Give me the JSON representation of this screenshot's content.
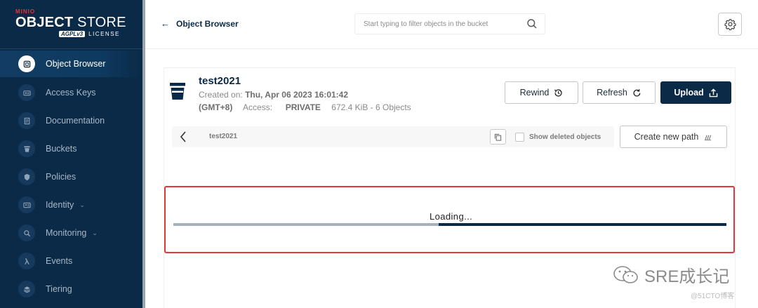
{
  "sidebar": {
    "logo": {
      "minio": "MINIO",
      "title_bold": "OBJECT",
      "title_rest": " STORE",
      "agpl": "AGPLv3",
      "license": "LICENSE"
    },
    "items": [
      {
        "label": "Object Browser",
        "icon": "object-browser-icon",
        "active": true
      },
      {
        "label": "Access Keys",
        "icon": "access-keys-icon"
      },
      {
        "label": "Documentation",
        "icon": "documentation-icon"
      },
      {
        "label": "Buckets",
        "icon": "buckets-icon"
      },
      {
        "label": "Policies",
        "icon": "policies-icon"
      },
      {
        "label": "Identity",
        "icon": "identity-icon",
        "expandable": true
      },
      {
        "label": "Monitoring",
        "icon": "monitoring-icon",
        "expandable": true
      },
      {
        "label": "Events",
        "icon": "events-icon"
      },
      {
        "label": "Tiering",
        "icon": "tiering-icon"
      }
    ]
  },
  "topbar": {
    "back_label": "Object Browser",
    "search_placeholder": "Start typing to filter objects in the bucket"
  },
  "bucket": {
    "name": "test2021",
    "created_label": "Created on:",
    "created_value": "Thu, Apr 06 2023 16:01:42",
    "timezone": "(GMT+8)",
    "access_label": "Access:",
    "access_value": "PRIVATE",
    "size_summary": "672.4 KiB - 6 Objects"
  },
  "actions": {
    "rewind": "Rewind",
    "refresh": "Refresh",
    "upload": "Upload",
    "create_path": "Create new path"
  },
  "browser": {
    "breadcrumb": "test2021",
    "show_deleted_label": "Show deleted objects",
    "show_deleted_checked": false
  },
  "loading": {
    "text": "Loading...",
    "progress": 0.52
  },
  "watermark": {
    "main": "SRE成长记",
    "small": "@51CTO博客"
  },
  "colors": {
    "sidebar_bg": "#0b2a47",
    "primary": "#0b2a47",
    "highlight_border": "#e2383a",
    "brand_red": "#e6313a"
  }
}
